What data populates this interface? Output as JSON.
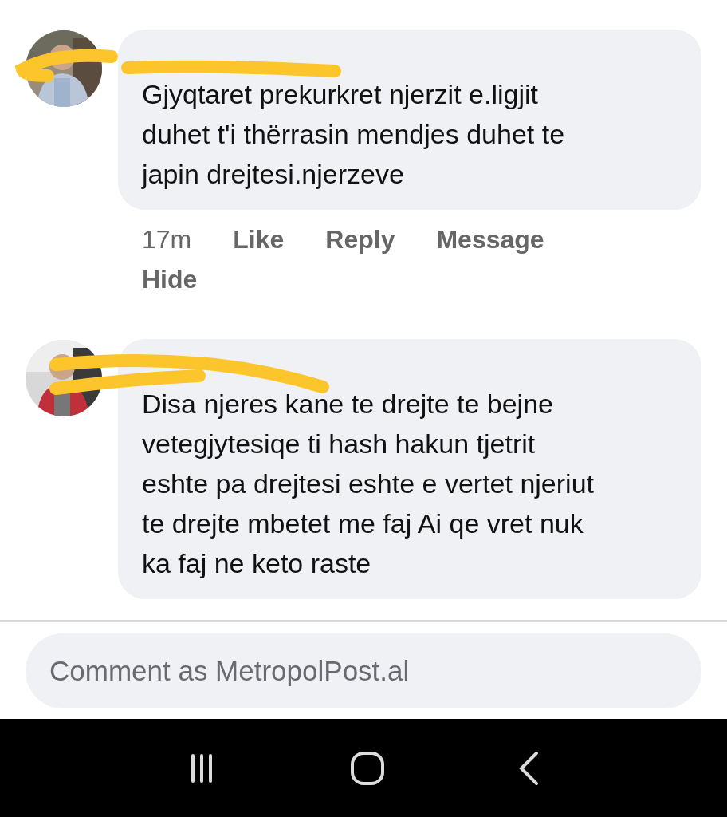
{
  "comments": [
    {
      "lines": [
        "Gjyqtaret prekurkret njerzit e.ligjit",
        "duhet t'i thërrasin mendjes duhet te",
        "japin drejtesi.njerzeve"
      ],
      "time": "17m",
      "actions": [
        "Like",
        "Reply",
        "Message",
        "Hide"
      ]
    },
    {
      "lines": [
        "Disa njeres kane te drejte te bejne",
        "vetegjytesiqe ti hash hakun tjetrit",
        "eshte pa drejtesi eshte e vertet njeriut",
        "te drejte mbetet me faj Ai qe vret nuk",
        "ka faj ne keto raste"
      ]
    }
  ],
  "composer": {
    "placeholder": "Comment as MetropolPost.al"
  }
}
